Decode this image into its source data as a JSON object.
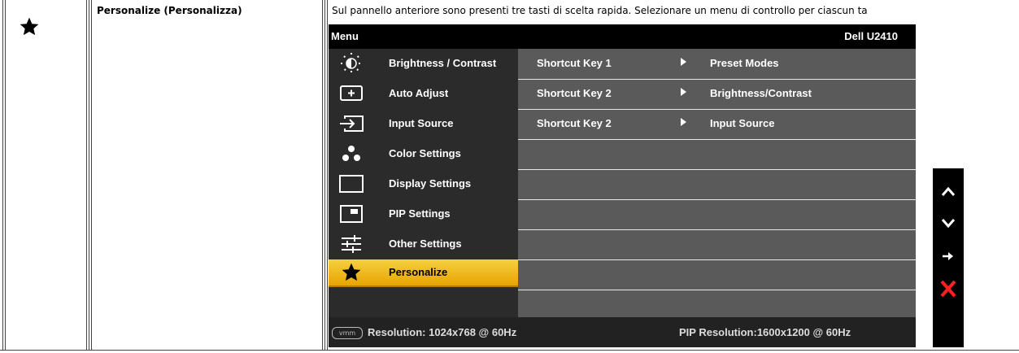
{
  "row": {
    "icon": "star-icon",
    "title": "Personalize (Personalizza)",
    "description": "Sul pannello anteriore sono presenti tre tasti di scelta rapida. Selezionare un menu di controllo per ciascun ta"
  },
  "osd": {
    "menu_title": "Menu",
    "model": "Dell U2410",
    "menu_items": [
      {
        "label": "Brightness / Contrast",
        "icon": "brightness-icon"
      },
      {
        "label": "Auto Adjust",
        "icon": "auto-adjust-icon"
      },
      {
        "label": "Input Source",
        "icon": "input-source-icon"
      },
      {
        "label": "Color Settings",
        "icon": "color-settings-icon"
      },
      {
        "label": "Display Settings",
        "icon": "display-settings-icon"
      },
      {
        "label": "PIP Settings",
        "icon": "pip-settings-icon"
      },
      {
        "label": "Other Settings",
        "icon": "other-settings-icon"
      },
      {
        "label": "Personalize",
        "icon": "star-icon",
        "selected": true
      }
    ],
    "shortcuts": [
      {
        "key": "Shortcut Key 1",
        "value": "Preset Modes"
      },
      {
        "key": "Shortcut Key 2",
        "value": "Brightness/Contrast"
      },
      {
        "key": "Shortcut Key 2",
        "value": "Input Source"
      }
    ],
    "resolution": "Resolution: 1024x768 @ 60Hz",
    "pip_resolution": "PIP Resolution:1600x1200 @ 60Hz",
    "vga_badge": "vmm"
  },
  "buttons": [
    {
      "icon": "up-arrow-icon"
    },
    {
      "icon": "down-arrow-icon"
    },
    {
      "icon": "right-arrow-icon"
    },
    {
      "icon": "close-icon",
      "color": "#ff2020"
    }
  ],
  "colors": {
    "selected_bg": "#f0c020",
    "left_panel": "#2b2b2b",
    "right_panel": "#5a5a5a"
  }
}
